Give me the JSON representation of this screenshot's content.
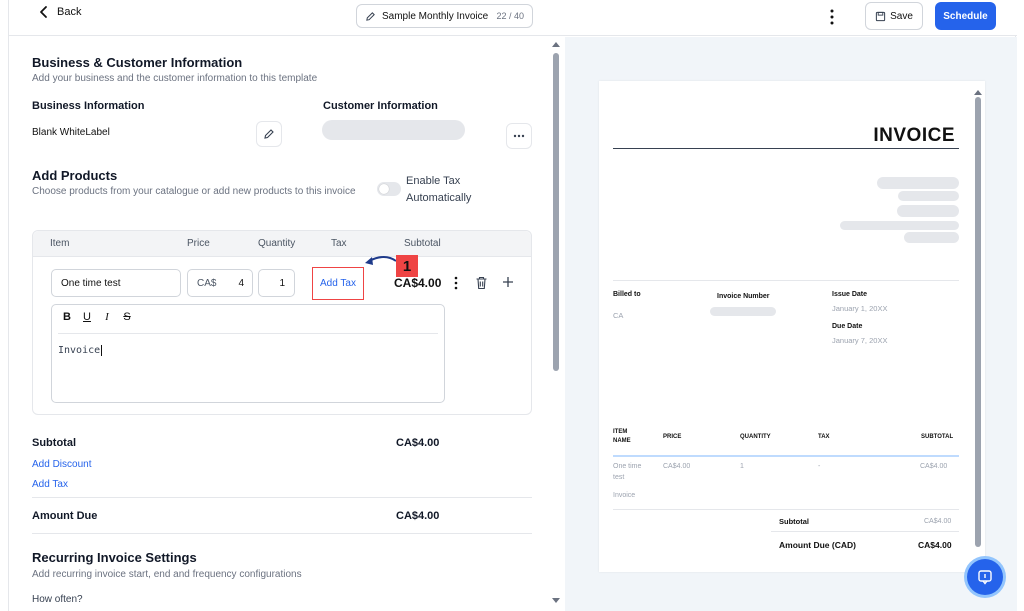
{
  "header": {
    "back_label": "Back",
    "template_name": "Sample Monthly Invoice",
    "char_count": "22 / 40",
    "save_label": "Save",
    "schedule_label": "Schedule"
  },
  "business_customer": {
    "title": "Business & Customer Information",
    "subtitle": "Add your business and the customer information to this template",
    "business_label": "Business Information",
    "business_name": "Blank WhiteLabel",
    "customer_label": "Customer Information"
  },
  "products": {
    "title": "Add Products",
    "subtitle": "Choose products from your catalogue or add new products to this invoice",
    "enable_tax_label": "Enable Tax Automatically",
    "columns": [
      "Item",
      "Price",
      "Quantity",
      "Tax",
      "Subtotal"
    ],
    "row": {
      "item": "One time test",
      "currency": "CA$",
      "price": "4",
      "quantity": "1",
      "add_tax": "Add Tax",
      "subtotal": "CA$4.00"
    },
    "editor_tools": [
      "B",
      "U",
      "I",
      "S"
    ],
    "description": "Invoice",
    "annotation_number": "1"
  },
  "totals": {
    "subtotal_label": "Subtotal",
    "subtotal_value": "CA$4.00",
    "add_discount": "Add Discount",
    "add_tax": "Add Tax",
    "amount_due_label": "Amount Due",
    "amount_due_value": "CA$4.00"
  },
  "recurring": {
    "title": "Recurring Invoice Settings",
    "subtitle": "Add recurring invoice start, end and frequency configurations",
    "how_often": "How often?"
  },
  "preview": {
    "title": "INVOICE",
    "billed_to_label": "Billed to",
    "billed_to_value": "CA",
    "invoice_number_label": "Invoice Number",
    "issue_date_label": "Issue Date",
    "issue_date_value": "January 1, 20XX",
    "due_date_label": "Due Date",
    "due_date_value": "January 7, 20XX",
    "table_headers": [
      "ITEM NAME",
      "PRICE",
      "QUANTITY",
      "TAX",
      "SUBTOTAL"
    ],
    "row": {
      "item": "One time test",
      "description": "Invoice",
      "price": "CA$4.00",
      "quantity": "1",
      "tax": "-",
      "subtotal": "CA$4.00"
    },
    "subtotal_label": "Subtotal",
    "subtotal_value": "CA$4.00",
    "amount_due_label": "Amount Due (CAD)",
    "amount_due_value": "CA$4.00"
  },
  "colors": {
    "accent": "#2563eb",
    "annotation": "#ef4444"
  }
}
